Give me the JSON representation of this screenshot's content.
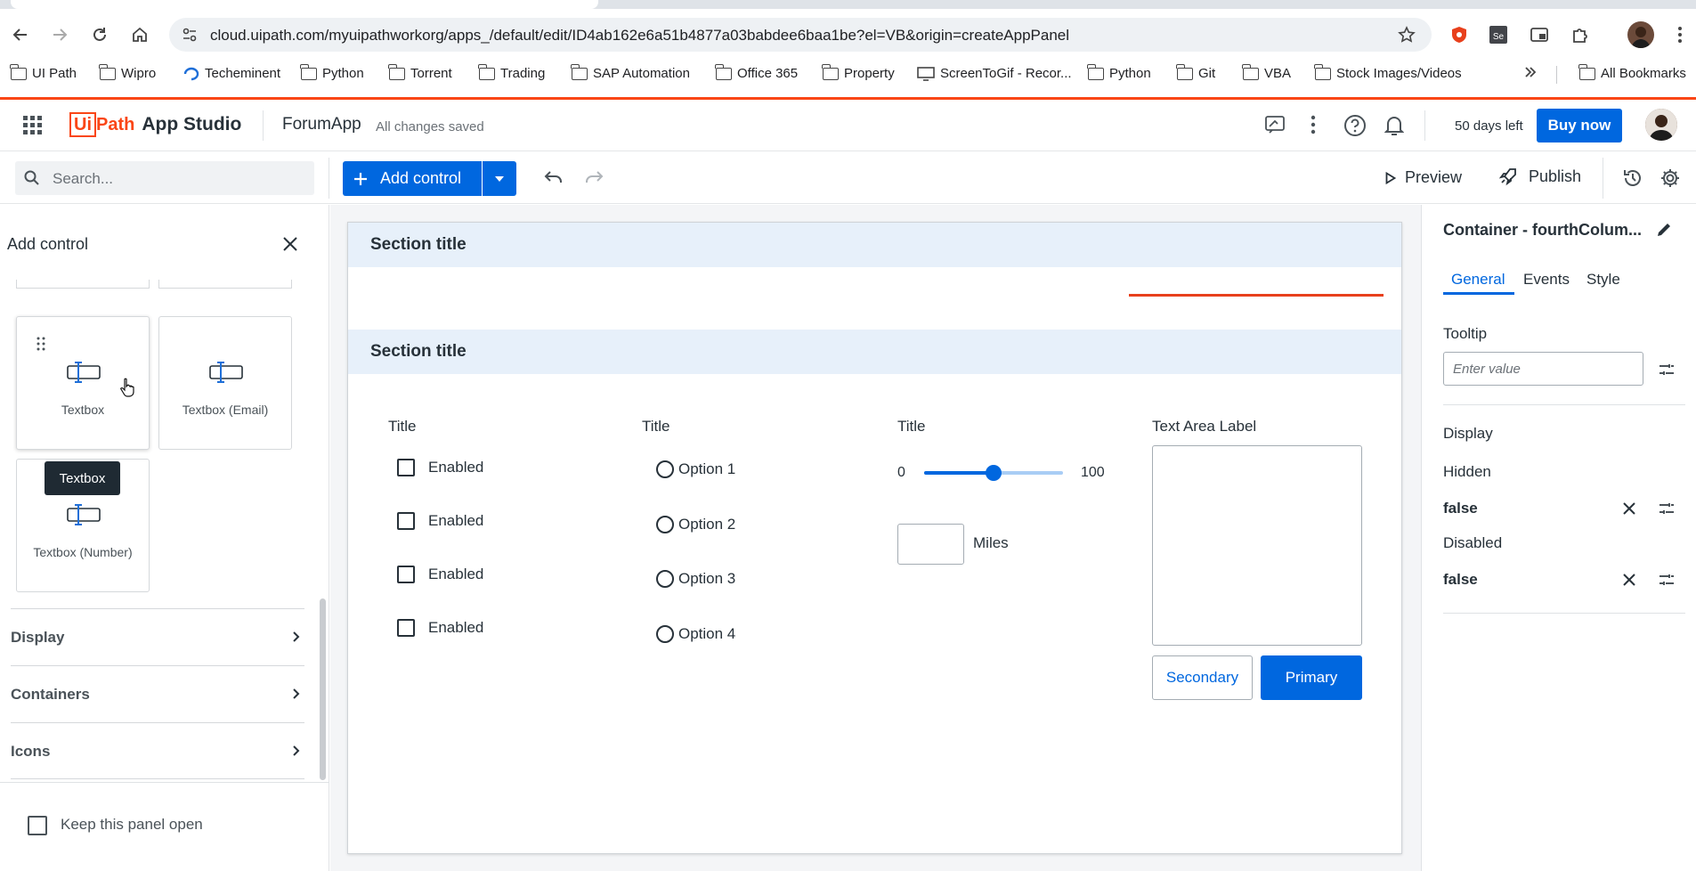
{
  "browser": {
    "url": "cloud.uipath.com/myuipathworkorg/apps_/default/edit/ID4ab162e6a51b4877a03babdee6baa1be?el=VB&origin=createAppPanel",
    "bookmarks": [
      "UI Path",
      "Wipro",
      "Techeminent",
      "Python",
      "Torrent",
      "Trading",
      "SAP Automation",
      "Office 365",
      "Property",
      "ScreenToGif - Recor...",
      "Python",
      "Git",
      "VBA",
      "Stock Images/Videos"
    ],
    "all_bookmarks": "All Bookmarks"
  },
  "app": {
    "logo_ui": "Ui",
    "logo_path": "Path",
    "studio": "App Studio",
    "project_name": "ForumApp",
    "save_status": "All changes saved",
    "trial": "50 days left",
    "buy_now": "Buy now"
  },
  "toolbar": {
    "search_placeholder": "Search...",
    "add_control": "Add control",
    "preview": "Preview",
    "publish": "Publish"
  },
  "left_panel": {
    "title": "Add control",
    "tiles": [
      "Textbox",
      "Textbox (Email)",
      "Textbox (Number)"
    ],
    "tooltip": "Textbox",
    "accordions": [
      "Display",
      "Containers",
      "Icons"
    ],
    "keep_open": "Keep this panel open"
  },
  "canvas": {
    "section1_title": "Section title",
    "section2_title": "Section title",
    "checkbox_col": {
      "title": "Title",
      "items": [
        "Enabled",
        "Enabled",
        "Enabled",
        "Enabled"
      ]
    },
    "radio_col": {
      "title": "Title",
      "items": [
        "Option 1",
        "Option 2",
        "Option 3",
        "Option 4"
      ]
    },
    "slider_col": {
      "title": "Title",
      "min": "0",
      "max": "100",
      "value": 0.5,
      "unit": "Miles"
    },
    "textarea_col": {
      "label": "Text Area Label",
      "secondary": "Secondary",
      "primary": "Primary"
    }
  },
  "right_panel": {
    "title": "Container - fourthColum...",
    "tabs": [
      "General",
      "Events",
      "Style"
    ],
    "tooltip_label": "Tooltip",
    "tooltip_placeholder": "Enter value",
    "display_label": "Display",
    "hidden_label": "Hidden",
    "hidden_value": "false",
    "disabled_label": "Disabled",
    "disabled_value": "false"
  },
  "colors": {
    "accent": "#0067df",
    "brand": "#fa4616",
    "section": "#e7f0fa"
  }
}
